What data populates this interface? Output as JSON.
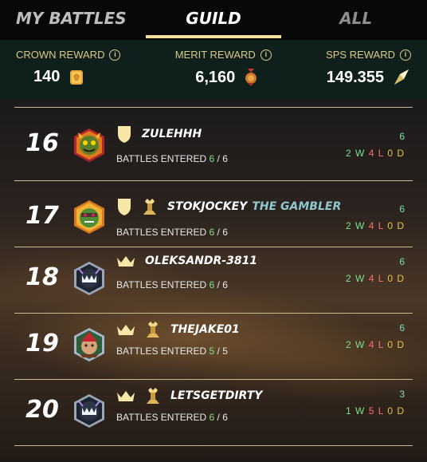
{
  "tabs": [
    {
      "label": "MY BATTLES",
      "active": false
    },
    {
      "label": "GUILD",
      "active": true
    },
    {
      "label": "ALL",
      "active": false
    }
  ],
  "rewards": {
    "crown": {
      "label": "CROWN REWARD",
      "value": "140",
      "icon": "crown-token-icon"
    },
    "merit": {
      "label": "MERIT REWARD",
      "value": "6,160",
      "icon": "merit-medal-icon"
    },
    "sps": {
      "label": "SPS REWARD",
      "value": "149.355",
      "icon": "sps-crystal-icon"
    }
  },
  "entered_label": "BATTLES ENTERED",
  "players": [
    {
      "rank": "16",
      "name": "ZULEHHH",
      "title": "",
      "entered": "6",
      "total": "6",
      "score": "6",
      "w": "2",
      "l": "4",
      "d": "0",
      "badges": [
        "shield-icon"
      ],
      "avatar": "avatar-gremlin"
    },
    {
      "rank": "17",
      "name": "STOKJOCKEY",
      "title": "THE GAMBLER",
      "entered": "6",
      "total": "6",
      "score": "6",
      "w": "2",
      "l": "4",
      "d": "0",
      "badges": [
        "shield-icon",
        "tower-icon"
      ],
      "avatar": "avatar-goblin"
    },
    {
      "rank": "18",
      "name": "OLEKSANDR-3811",
      "title": "",
      "entered": "6",
      "total": "6",
      "score": "6",
      "w": "2",
      "l": "4",
      "d": "0",
      "badges": [
        "crown-icon"
      ],
      "avatar": "avatar-monster"
    },
    {
      "rank": "19",
      "name": "THEJAKE01",
      "title": "",
      "entered": "5",
      "total": "5",
      "score": "6",
      "w": "2",
      "l": "4",
      "d": "0",
      "badges": [
        "crown-icon",
        "tower-icon"
      ],
      "avatar": "avatar-archer"
    },
    {
      "rank": "20",
      "name": "LETSGETDIRTY",
      "title": "",
      "entered": "6",
      "total": "6",
      "score": "3",
      "w": "1",
      "l": "5",
      "d": "0",
      "badges": [
        "crown-icon",
        "tower-icon"
      ],
      "avatar": "avatar-monster"
    }
  ],
  "colors": {
    "accent": "#f2df9d",
    "win": "#7de08b",
    "loss": "#ff6f6f",
    "draw": "#e8c24a",
    "reward_bg": "#0f1f1c"
  }
}
